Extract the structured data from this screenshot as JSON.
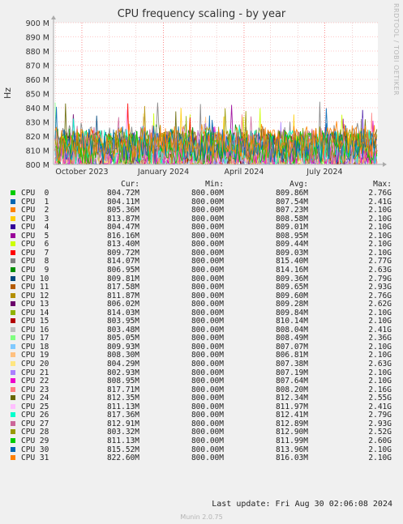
{
  "chart_data": {
    "type": "line",
    "title": "CPU frequency scaling - by year",
    "ylabel": "Hz",
    "ylim": [
      800,
      900
    ],
    "y_unit": "M",
    "y_ticks": [
      800,
      810,
      820,
      830,
      840,
      850,
      860,
      870,
      880,
      890,
      900
    ],
    "y_tick_labels": [
      "800 M",
      "810 M",
      "820 M",
      "830 M",
      "840 M",
      "850 M",
      "860 M",
      "870 M",
      "880 M",
      "890 M",
      "900 M"
    ],
    "x_range": [
      "2023-08-30",
      "2024-08-30"
    ],
    "x_ticks": [
      "2023-10-01",
      "2024-01-01",
      "2024-04-01",
      "2024-07-01"
    ],
    "x_tick_labels": [
      "October 2023",
      "January 2024",
      "April 2024",
      "July 2024"
    ],
    "grid": true,
    "side_label": "RRDTOOL / TOBI OETIKER",
    "columns": [
      "Cur:",
      "Min:",
      "Avg:",
      "Max:"
    ],
    "series": [
      {
        "name": "CPU  0",
        "color": "#00cc00",
        "cur": "804.72M",
        "min": "800.00M",
        "avg": "809.86M",
        "max": "2.76G",
        "avg_mhz": 809.86
      },
      {
        "name": "CPU  1",
        "color": "#0066b3",
        "cur": "804.11M",
        "min": "800.00M",
        "avg": "807.54M",
        "max": "2.41G",
        "avg_mhz": 807.54
      },
      {
        "name": "CPU  2",
        "color": "#ff8000",
        "cur": "805.36M",
        "min": "800.00M",
        "avg": "807.23M",
        "max": "2.10G",
        "avg_mhz": 807.23
      },
      {
        "name": "CPU  3",
        "color": "#ffcc00",
        "cur": "813.87M",
        "min": "800.00M",
        "avg": "808.58M",
        "max": "2.10G",
        "avg_mhz": 808.58
      },
      {
        "name": "CPU  4",
        "color": "#330099",
        "cur": "804.47M",
        "min": "800.00M",
        "avg": "809.01M",
        "max": "2.10G",
        "avg_mhz": 809.01
      },
      {
        "name": "CPU  5",
        "color": "#990099",
        "cur": "816.16M",
        "min": "800.00M",
        "avg": "808.95M",
        "max": "2.10G",
        "avg_mhz": 808.95
      },
      {
        "name": "CPU  6",
        "color": "#ccff00",
        "cur": "813.40M",
        "min": "800.00M",
        "avg": "809.44M",
        "max": "2.10G",
        "avg_mhz": 809.44
      },
      {
        "name": "CPU  7",
        "color": "#ff0000",
        "cur": "809.72M",
        "min": "800.00M",
        "avg": "809.03M",
        "max": "2.10G",
        "avg_mhz": 809.03
      },
      {
        "name": "CPU  8",
        "color": "#808080",
        "cur": "814.07M",
        "min": "800.00M",
        "avg": "815.40M",
        "max": "2.77G",
        "avg_mhz": 815.4
      },
      {
        "name": "CPU  9",
        "color": "#008f00",
        "cur": "806.95M",
        "min": "800.00M",
        "avg": "814.16M",
        "max": "2.63G",
        "avg_mhz": 814.16
      },
      {
        "name": "CPU 10",
        "color": "#00487d",
        "cur": "809.81M",
        "min": "800.00M",
        "avg": "809.36M",
        "max": "2.79G",
        "avg_mhz": 809.36
      },
      {
        "name": "CPU 11",
        "color": "#b35a00",
        "cur": "817.58M",
        "min": "800.00M",
        "avg": "809.65M",
        "max": "2.93G",
        "avg_mhz": 809.65
      },
      {
        "name": "CPU 12",
        "color": "#b38f00",
        "cur": "811.87M",
        "min": "800.00M",
        "avg": "809.60M",
        "max": "2.76G",
        "avg_mhz": 809.6
      },
      {
        "name": "CPU 13",
        "color": "#6b006b",
        "cur": "806.02M",
        "min": "800.00M",
        "avg": "809.28M",
        "max": "2.62G",
        "avg_mhz": 809.28
      },
      {
        "name": "CPU 14",
        "color": "#8fb300",
        "cur": "814.03M",
        "min": "800.00M",
        "avg": "809.84M",
        "max": "2.10G",
        "avg_mhz": 809.84
      },
      {
        "name": "CPU 15",
        "color": "#b30000",
        "cur": "803.95M",
        "min": "800.00M",
        "avg": "810.14M",
        "max": "2.10G",
        "avg_mhz": 810.14
      },
      {
        "name": "CPU 16",
        "color": "#bebebe",
        "cur": "803.48M",
        "min": "800.00M",
        "avg": "808.04M",
        "max": "2.41G",
        "avg_mhz": 808.04
      },
      {
        "name": "CPU 17",
        "color": "#80ff80",
        "cur": "805.05M",
        "min": "800.00M",
        "avg": "808.49M",
        "max": "2.36G",
        "avg_mhz": 808.49
      },
      {
        "name": "CPU 18",
        "color": "#80c9ff",
        "cur": "809.93M",
        "min": "800.00M",
        "avg": "807.07M",
        "max": "2.10G",
        "avg_mhz": 807.07
      },
      {
        "name": "CPU 19",
        "color": "#ffc080",
        "cur": "808.30M",
        "min": "800.00M",
        "avg": "806.81M",
        "max": "2.10G",
        "avg_mhz": 806.81
      },
      {
        "name": "CPU 20",
        "color": "#ffe680",
        "cur": "804.29M",
        "min": "800.00M",
        "avg": "807.38M",
        "max": "2.63G",
        "avg_mhz": 807.38
      },
      {
        "name": "CPU 21",
        "color": "#aa80ff",
        "cur": "802.93M",
        "min": "800.00M",
        "avg": "807.19M",
        "max": "2.10G",
        "avg_mhz": 807.19
      },
      {
        "name": "CPU 22",
        "color": "#ee00cc",
        "cur": "808.95M",
        "min": "800.00M",
        "avg": "807.64M",
        "max": "2.10G",
        "avg_mhz": 807.64
      },
      {
        "name": "CPU 23",
        "color": "#ff8080",
        "cur": "817.71M",
        "min": "800.00M",
        "avg": "808.20M",
        "max": "2.16G",
        "avg_mhz": 808.2
      },
      {
        "name": "CPU 24",
        "color": "#666600",
        "cur": "812.35M",
        "min": "800.00M",
        "avg": "812.34M",
        "max": "2.55G",
        "avg_mhz": 812.34
      },
      {
        "name": "CPU 25",
        "color": "#ffbfff",
        "cur": "811.13M",
        "min": "800.00M",
        "avg": "811.97M",
        "max": "2.41G",
        "avg_mhz": 811.97
      },
      {
        "name": "CPU 26",
        "color": "#00ffcc",
        "cur": "817.36M",
        "min": "800.00M",
        "avg": "812.41M",
        "max": "2.79G",
        "avg_mhz": 812.41
      },
      {
        "name": "CPU 27",
        "color": "#cc6699",
        "cur": "812.91M",
        "min": "800.00M",
        "avg": "812.89M",
        "max": "2.93G",
        "avg_mhz": 812.89
      },
      {
        "name": "CPU 28",
        "color": "#999900",
        "cur": "803.32M",
        "min": "800.00M",
        "avg": "812.90M",
        "max": "2.52G",
        "avg_mhz": 812.9
      },
      {
        "name": "CPU 29",
        "color": "#00cc00",
        "cur": "811.13M",
        "min": "800.00M",
        "avg": "811.99M",
        "max": "2.60G",
        "avg_mhz": 811.99
      },
      {
        "name": "CPU 30",
        "color": "#0066b3",
        "cur": "815.52M",
        "min": "800.00M",
        "avg": "813.96M",
        "max": "2.10G",
        "avg_mhz": 813.96
      },
      {
        "name": "CPU 31",
        "color": "#ff8000",
        "cur": "822.60M",
        "min": "800.00M",
        "avg": "816.03M",
        "max": "2.10G",
        "avg_mhz": 816.03
      }
    ]
  },
  "last_update": "Last update:  Fri Aug 30 02:06:08 2024",
  "footer": "Munin 2.0.75"
}
